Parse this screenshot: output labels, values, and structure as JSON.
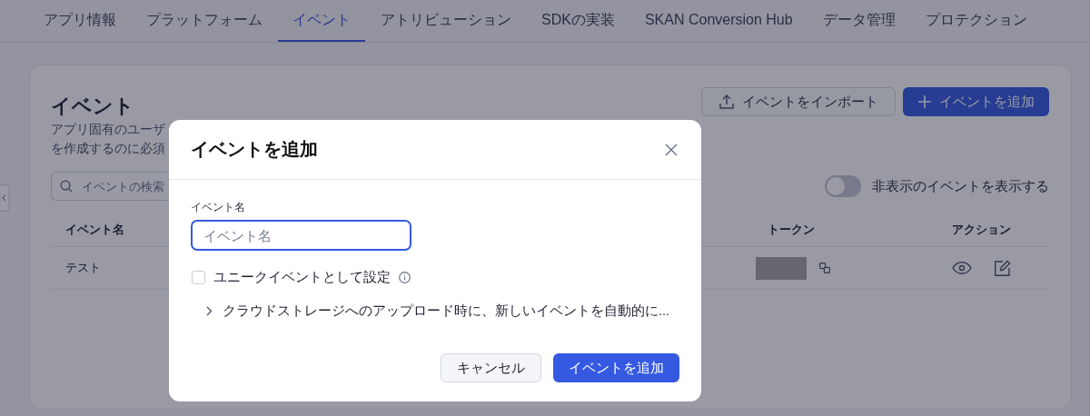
{
  "tabs": [
    {
      "label": "アプリ情報",
      "selected": false
    },
    {
      "label": "プラットフォーム",
      "selected": false
    },
    {
      "label": "イベント",
      "selected": true
    },
    {
      "label": "アトリビューション",
      "selected": false
    },
    {
      "label": "SDKの実装",
      "selected": false
    },
    {
      "label": "SKAN Conversion Hub",
      "selected": false
    },
    {
      "label": "データ管理",
      "selected": false
    },
    {
      "label": "プロテクション",
      "selected": false
    }
  ],
  "page": {
    "title": "イベント",
    "description_lines": [
      "アプリ固有のユーザ",
      "を作成するのに必須"
    ],
    "import_button": "イベントをインポート",
    "add_button": "イベントを追加",
    "search": {
      "placeholder": "イベントの検索"
    },
    "toggle": {
      "label": "非表示のイベントを表示する",
      "on": false
    },
    "table": {
      "columns": [
        "イベント名",
        "トークン",
        "アクション"
      ],
      "rows": [
        {
          "name": "テスト"
        }
      ]
    }
  },
  "modal": {
    "title": "イベントを追加",
    "field": {
      "label": "イベント名",
      "placeholder": "イベント名"
    },
    "checkbox": {
      "label": "ユニークイベントとして設定",
      "checked": false
    },
    "expander": {
      "label": "クラウドストレージへのアップロード時に、新しいイベントを自動的に...",
      "expanded": false
    },
    "cancel_button": "キャンセル",
    "submit_button": "イベントを追加"
  }
}
